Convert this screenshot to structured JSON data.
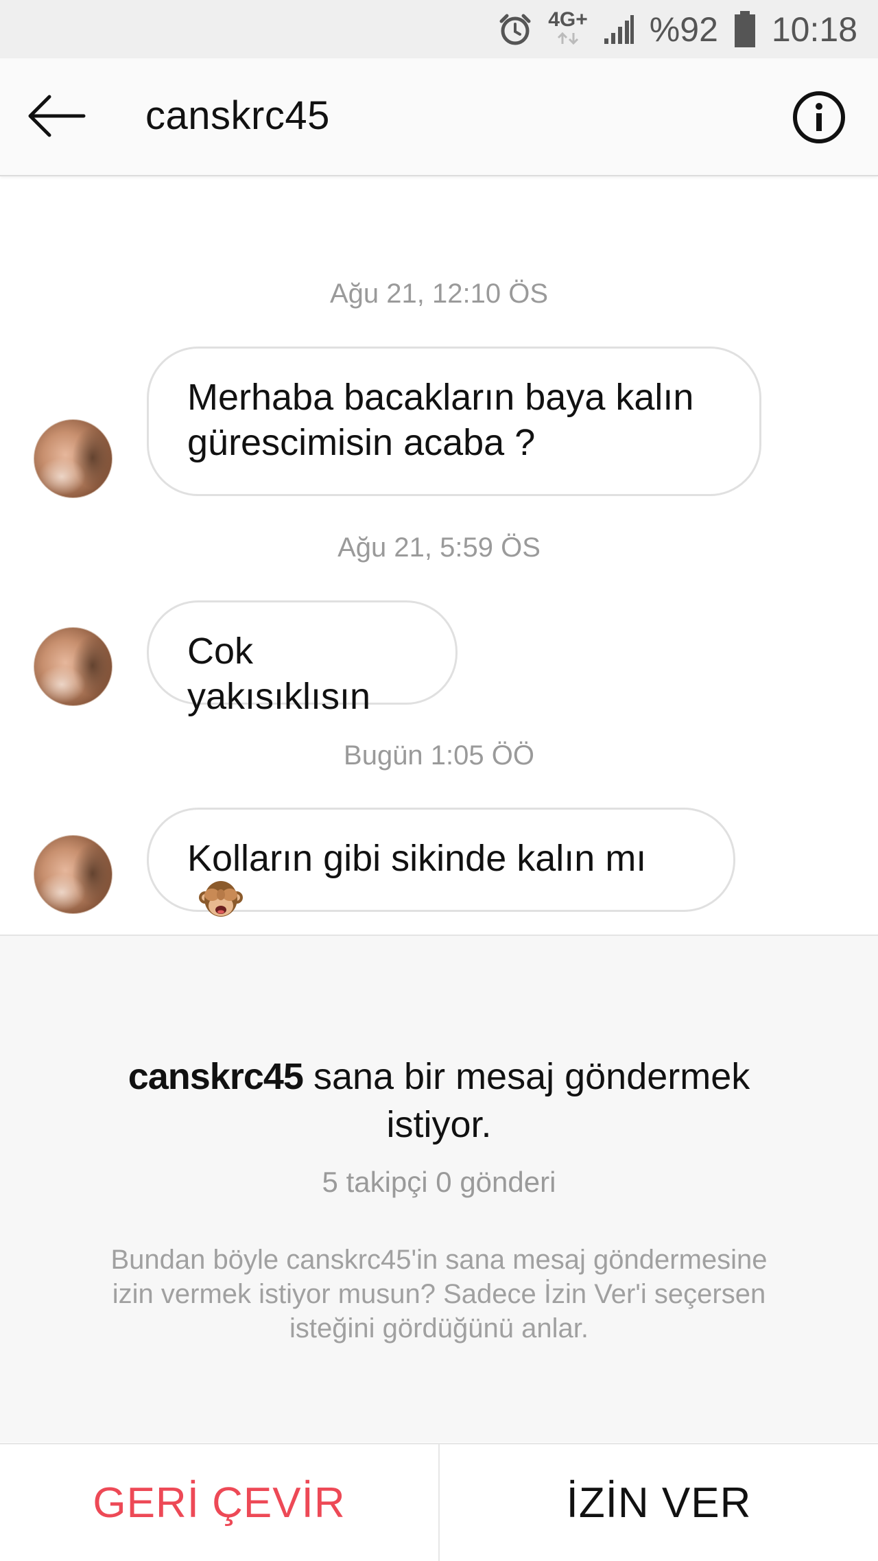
{
  "status_bar": {
    "network": "4G+",
    "battery_percent": "%92",
    "time": "10:18",
    "icons": [
      "alarm-icon",
      "network-icon",
      "signal-icon",
      "battery-icon"
    ]
  },
  "header": {
    "title": "canskrc45",
    "back_icon": "arrow-left-icon",
    "info_icon": "info-icon"
  },
  "messages": [
    {
      "timestamp": "Ağu 21, 12:10 ÖS",
      "lines": [
        "Merhaba bacakların baya kalın",
        "gürescimisin acaba ?"
      ]
    },
    {
      "timestamp": "Ağu 21, 5:59 ÖS",
      "lines": [
        "Cok yakısıklısın"
      ]
    },
    {
      "timestamp": "Bugün 1:05 ÖÖ",
      "lines": [
        "Kolların gibi sikinde kalın mı"
      ],
      "emoji": "see-no-evil-monkey"
    }
  ],
  "request": {
    "username": "canskrc45",
    "text": "sana bir mesaj göndermek istiyor.",
    "stats": "5 takipçi 0 gönderi",
    "note": "Bundan böyle canskrc45'in sana mesaj göndermesine izin vermek istiyor musun? Sadece İzin Ver'i seçersen isteğini gördüğünü anlar."
  },
  "actions": {
    "decline_label": "GERİ ÇEVİR",
    "accept_label": "İZİN VER"
  },
  "colors": {
    "decline": "#ed4956",
    "panel_background": "#f7f7f7",
    "timestamp_text": "#9a9a9a"
  }
}
